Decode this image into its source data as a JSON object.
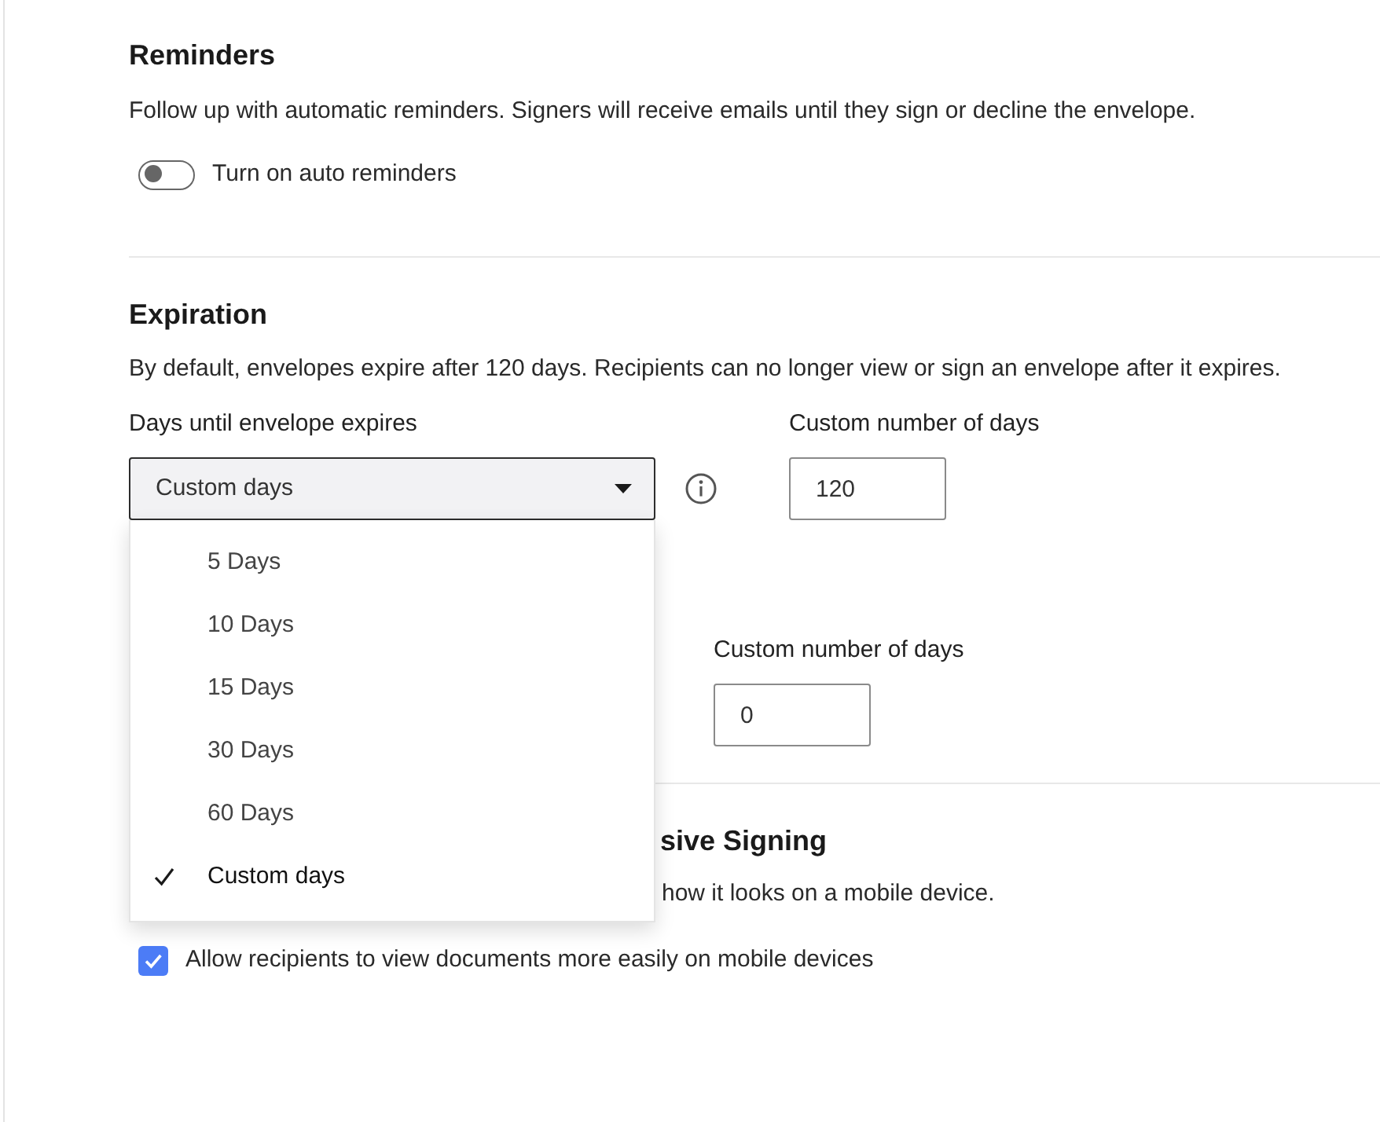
{
  "reminders": {
    "title": "Reminders",
    "description": "Follow up with automatic reminders. Signers will receive emails until they sign or decline the envelope.",
    "toggle": {
      "label": "Turn on auto reminders",
      "on": false
    }
  },
  "expiration": {
    "title": "Expiration",
    "description": "By default, envelopes expire after 120 days. Recipients can no longer view or sign an envelope after it expires.",
    "days_select": {
      "label": "Days until envelope expires",
      "value": "Custom days",
      "expanded": true,
      "options": [
        {
          "label": "5 Days",
          "selected": false
        },
        {
          "label": "10 Days",
          "selected": false
        },
        {
          "label": "15 Days",
          "selected": false
        },
        {
          "label": "30 Days",
          "selected": false
        },
        {
          "label": "60 Days",
          "selected": false
        },
        {
          "label": "Custom days",
          "selected": true
        }
      ]
    },
    "custom_day_fields": [
      {
        "label": "Custom number of days",
        "value": "120"
      },
      {
        "label": "Custom number of days",
        "value": "0"
      }
    ]
  },
  "responsive_signing": {
    "title": "sive Signing",
    "description": "how it looks on a mobile device.",
    "checkbox": {
      "label": "Allow recipients to view documents more easily on mobile devices",
      "checked": true
    }
  }
}
